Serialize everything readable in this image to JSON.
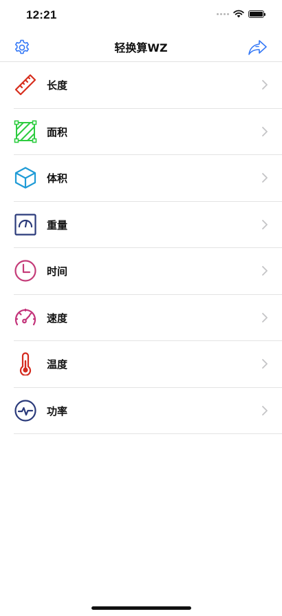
{
  "status_bar": {
    "time": "12:21",
    "battery_level": 1.0
  },
  "nav": {
    "title": "轻换算WZ",
    "left_icon": "gear-icon",
    "right_icon": "share-arrow-icon"
  },
  "colors": {
    "accent": "#3478f6",
    "length": "#d72f1e",
    "area": "#2ecc40",
    "volume": "#1f9bd6",
    "weight": "#2a3a7a",
    "time": "#c43b78",
    "speed": "#c3337a",
    "temperature": "#d42a1e",
    "power": "#2a3a7a"
  },
  "items": [
    {
      "label": "长度",
      "icon": "ruler-icon"
    },
    {
      "label": "面积",
      "icon": "area-square-icon"
    },
    {
      "label": "体积",
      "icon": "cube-icon"
    },
    {
      "label": "重量",
      "icon": "scale-icon"
    },
    {
      "label": "时间",
      "icon": "clock-icon"
    },
    {
      "label": "速度",
      "icon": "speedometer-icon"
    },
    {
      "label": "温度",
      "icon": "thermometer-icon"
    },
    {
      "label": "功率",
      "icon": "power-pulse-icon"
    }
  ]
}
